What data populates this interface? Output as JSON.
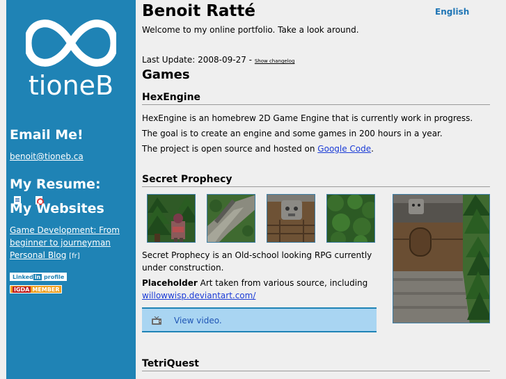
{
  "sidebar": {
    "logo_text": "tioneB",
    "email_heading": "Email Me!",
    "email": "benoit@tioneb.ca",
    "resume_heading": "My Resume:",
    "websites_heading": "My Websites",
    "websites": [
      {
        "label": "Game Development: From beginner to journeyman"
      },
      {
        "label": "Personal Blog",
        "suffix": "[fr]"
      }
    ],
    "badges": {
      "linkedin_pre": "Linked",
      "linkedin_in": "in",
      "linkedin_post": "profile",
      "igda_tag": "IGDA",
      "igda_text": "MEMBER"
    },
    "colors": {
      "background": "#1f83b5"
    }
  },
  "header": {
    "name": "Benoit Ratté",
    "language_link": "English",
    "welcome": "Welcome to my online portfolio. Take a look around.",
    "last_update_label": "Last Update: 2008-09-27 -",
    "changelog_link": "Show changelog"
  },
  "main": {
    "section_title": "Games",
    "hexengine": {
      "title": "HexEngine",
      "line1": "HexEngine is an homebrew 2D Game Engine that is currently work in progress.",
      "line2": "The goal is to create an engine and some games in 200 hours in a year.",
      "line3_pre": "The project is open source and hosted on ",
      "line3_link": "Google Code",
      "line3_post": "."
    },
    "secret_prophecy": {
      "title": "Secret Prophecy",
      "desc_line1": "Secret Prophecy is an Old-school looking RPG currently",
      "desc_line2": "under construction.",
      "placeholder_bold": "Placeholder",
      "placeholder_text": " Art taken from various source, including",
      "art_link": "willowwisp.deviantart.com/",
      "video_link": "View video.",
      "screenshots": [
        "knight-in-forest",
        "stone-path",
        "gargoyle-door",
        "forest-canopy"
      ]
    },
    "tetriquest": {
      "title": "TetriQuest"
    }
  }
}
